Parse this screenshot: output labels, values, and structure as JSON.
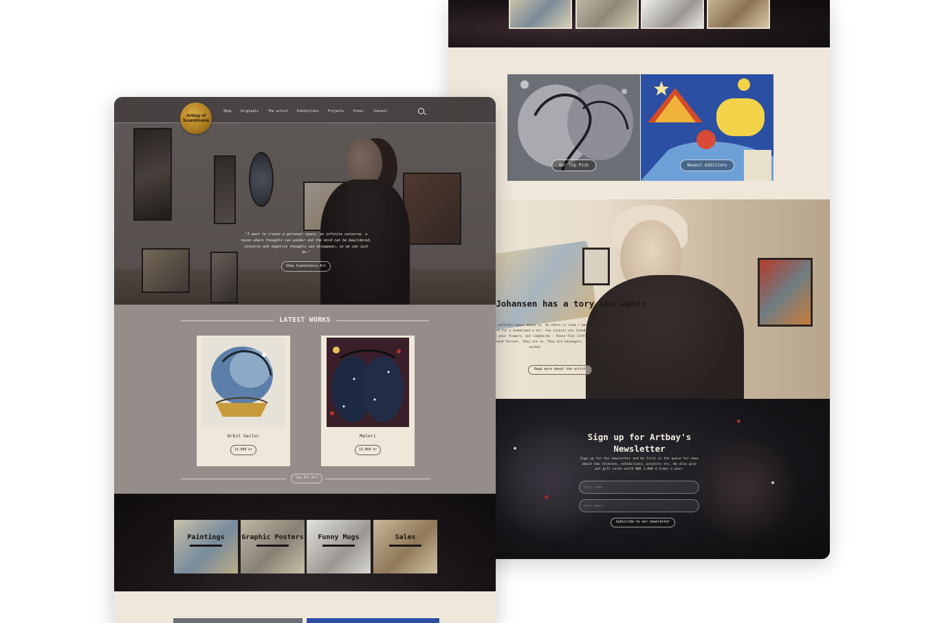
{
  "nav": {
    "logo_text": "Artbay of Scandinavia",
    "items": [
      "Shop",
      "Originals",
      "The artist",
      "Exhibitions",
      "Projects",
      "Press",
      "Contact"
    ]
  },
  "hero": {
    "quote": "\"I want to create a personal space, an infinite universe, a haven where thoughts can wander and the mind can be bewildered, concerns and negative thoughts can disappear… so we can just be.\"",
    "button": "Shop Scandinavia Art"
  },
  "latest": {
    "title": "LATEST WORKS",
    "items": [
      {
        "name": "Orbit Sailor",
        "price": "14.000 kr"
      },
      {
        "name": "Maleri",
        "price": "19.000 kr"
      }
    ],
    "see_all": "See All Art"
  },
  "categories": [
    "Paintings",
    "Graphic Posters",
    "Funny Mugs",
    "Sales"
  ],
  "features": [
    {
      "label": "Our Top Pick"
    },
    {
      "label": "Newest Additions"
    }
  ],
  "story": {
    "title": "nne Marie Johansen has a tory she wants to tell",
    "text": "'s about heaven, the great infinite space above us. So there is room r many stories and it is quite a good place to start for a Gedebrænd e her. Few insects are loved by humans and even fewer are allowed to lk on your fingers, but ladybirds - those fine little red dots that eem to keep wandering on your hand forever, they are in. They are ansengers, the carriers of good wishes",
    "button": "Read more about the artist"
  },
  "newsletter": {
    "title": "Sign up for Artbay's Newsletter",
    "text": "Sign up for the newsletter and be first in the queue for news about new releases, exhibitions, projects etc. We also give out gift cards worth DKK 1,000 4 times a year.",
    "name_placeholder": "Your name",
    "email_placeholder": "Your email",
    "button": "Subscribe to our newsletter"
  },
  "colors": {
    "cream": "#efe8da",
    "taupe": "#948d8a",
    "dark": "#18141a",
    "gold": "#b07f22"
  }
}
